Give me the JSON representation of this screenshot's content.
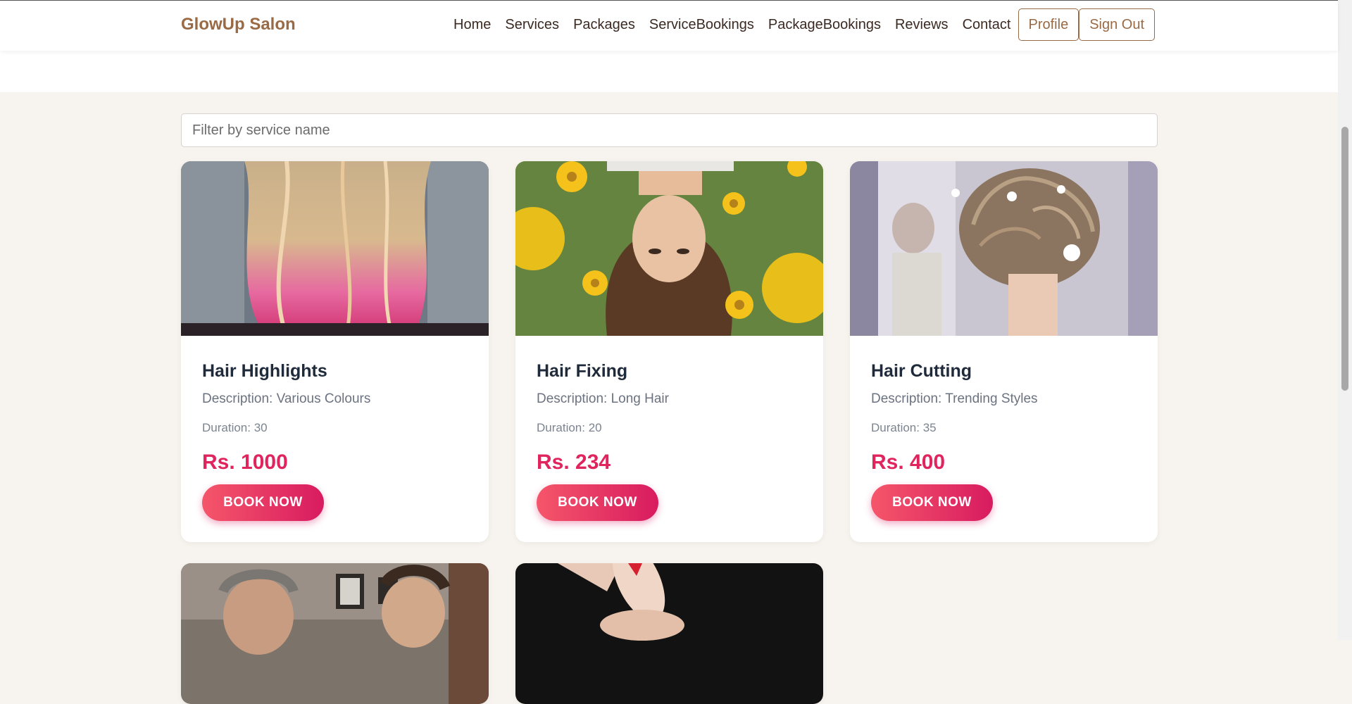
{
  "nav": {
    "brand": "GlowUp Salon",
    "links": [
      "Home",
      "Services",
      "Packages",
      "ServiceBookings",
      "PackageBookings",
      "Reviews",
      "Contact"
    ],
    "profile_label": "Profile",
    "signout_label": "Sign Out"
  },
  "filter": {
    "placeholder": "Filter by service name"
  },
  "services": [
    {
      "title": "Hair Highlights",
      "description": "Description: Various Colours",
      "duration": "Duration: 30",
      "price": "Rs. 1000",
      "button": "BOOK NOW"
    },
    {
      "title": "Hair Fixing",
      "description": "Description: Long Hair",
      "duration": "Duration: 20",
      "price": "Rs. 234",
      "button": "BOOK NOW"
    },
    {
      "title": "Hair Cutting",
      "description": "Description: Trending Styles",
      "duration": "Duration: 35",
      "price": "Rs. 400",
      "button": "BOOK NOW"
    }
  ],
  "colors": {
    "brand": "#9a6a45",
    "price": "#e0245e",
    "button_start": "#f5566a",
    "button_end": "#d81b60",
    "background": "#f7f3ee"
  }
}
